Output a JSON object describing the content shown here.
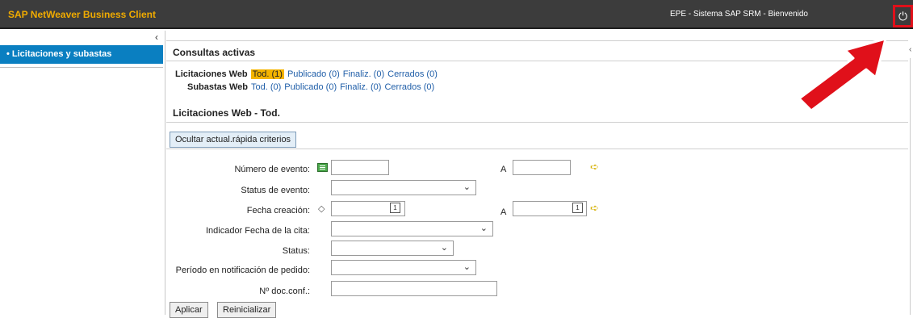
{
  "header": {
    "app_title": "SAP NetWeaver Business Client",
    "welcome": "EPE - Sistema SAP SRM - Bienvenido",
    "power_icon": "⏻"
  },
  "sidebar": {
    "collapse_icon": "‹",
    "items": [
      {
        "label": "•  Licitaciones y subastas"
      }
    ]
  },
  "active_queries": {
    "title": "Consultas activas",
    "rows": [
      {
        "label": "Licitaciones Web",
        "links": [
          "Tod. (1)",
          "Publicado (0)",
          "Finaliz. (0)",
          "Cerrados (0)"
        ]
      },
      {
        "label": "Subastas Web",
        "links": [
          "Tod. (0)",
          "Publicado (0)",
          "Finaliz. (0)",
          "Cerrados (0)"
        ]
      }
    ]
  },
  "list_section": {
    "title": "Licitaciones Web - Tod.",
    "toggle_button": "Ocultar actual.rápida criterios"
  },
  "form": {
    "event_number_label": "Número de evento:",
    "event_status_label": "Status de evento:",
    "creation_date_label": "Fecha creación:",
    "appointment_date_indicator_label": "Indicador Fecha de la cita:",
    "status_label": "Status:",
    "order_notification_period_label": "Período en notificación de pedido:",
    "confirmation_doc_label": "Nº doc.conf.:",
    "to_label": "A",
    "calendar_glyph": "1",
    "chevron": "⌄",
    "arrow_glyph": "➪",
    "diamond_glyph": "◇",
    "apply_button": "Aplicar",
    "reset_button": "Reinicializar"
  },
  "colors": {
    "accent": "#f0ab00",
    "nav_selected": "#0a7fc1",
    "annotation_arrow": "#e0101a"
  }
}
